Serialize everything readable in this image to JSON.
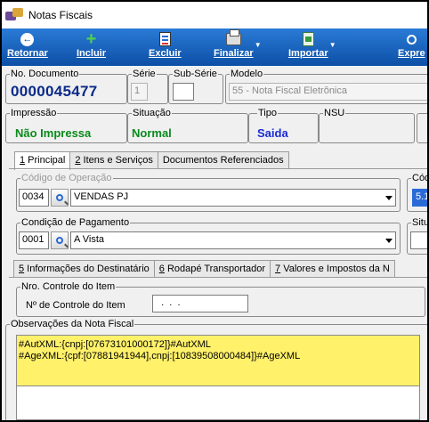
{
  "window": {
    "title": "Notas Fiscais"
  },
  "toolbar": {
    "buttons": [
      {
        "label": "Retornar",
        "icon": "back-circle-icon"
      },
      {
        "label": "Incluir",
        "icon": "plus-icon"
      },
      {
        "label": "Excluir",
        "icon": "delete-document-icon"
      },
      {
        "label": "Finalizar",
        "icon": "printer-icon"
      },
      {
        "label": "Importar",
        "icon": "import-icon"
      },
      {
        "label": "Expre",
        "icon": "search-icon"
      }
    ]
  },
  "header": {
    "doc_number_label": "No. Documento",
    "doc_number": "0000045477",
    "serie_label": "Série",
    "serie": "1",
    "subserie_label": "Sub-Série",
    "subserie": "",
    "modelo_label": "Modelo",
    "modelo": "55 - Nota Fiscal Eletrônica",
    "impressao_label": "Impressão",
    "impressao": "Não Impressa",
    "situacao_label": "Situação",
    "situacao": "Normal",
    "tipo_label": "Tipo",
    "tipo": "Saida",
    "nsu_label": "NSU"
  },
  "tabs_top": [
    {
      "key": "1",
      "label": " Principal"
    },
    {
      "key": "2",
      "label": " Itens e Serviços"
    },
    {
      "key": "",
      "label": "Documentos Referenciados"
    }
  ],
  "principal": {
    "operacao_label": "Código de Operação",
    "operacao_code": "0034",
    "operacao_desc": "VENDAS PJ",
    "cod_cut_label": "Cód",
    "cod_cut_value": "5.1",
    "pagamento_label": "Condição de Pagamento",
    "pagamento_code": "0001",
    "pagamento_desc": "A Vista",
    "situ_cut_label": "Situ"
  },
  "tabs_bottom": [
    {
      "key": "5",
      "label": " Informações do Destinatário"
    },
    {
      "key": "6",
      "label": " Rodapé Transportador"
    },
    {
      "key": "7",
      "label": " Valores e Impostos da N"
    }
  ],
  "item_control": {
    "group_label": "Nro. Controle do Item",
    "field_label": "Nº de Controle do Item",
    "field_value": "  .  .  .  "
  },
  "observacoes": {
    "label": "Observações da Nota Fiscal",
    "lines": [
      "#AutXML:{cnpj:[07673101000172]}#AutXML",
      "#AgeXML:{cpf:[07881941944],cnpj:[10839508000484]}#AgeXML"
    ]
  },
  "colors": {
    "toolbar_top": "#2a7bd6",
    "toolbar_bottom": "#0d4fa6",
    "doc_number": "#0b2a8a",
    "status_green": "#0a8a1a",
    "tipo_blue": "#1a2ad6",
    "obs_background": "#fff16a"
  }
}
